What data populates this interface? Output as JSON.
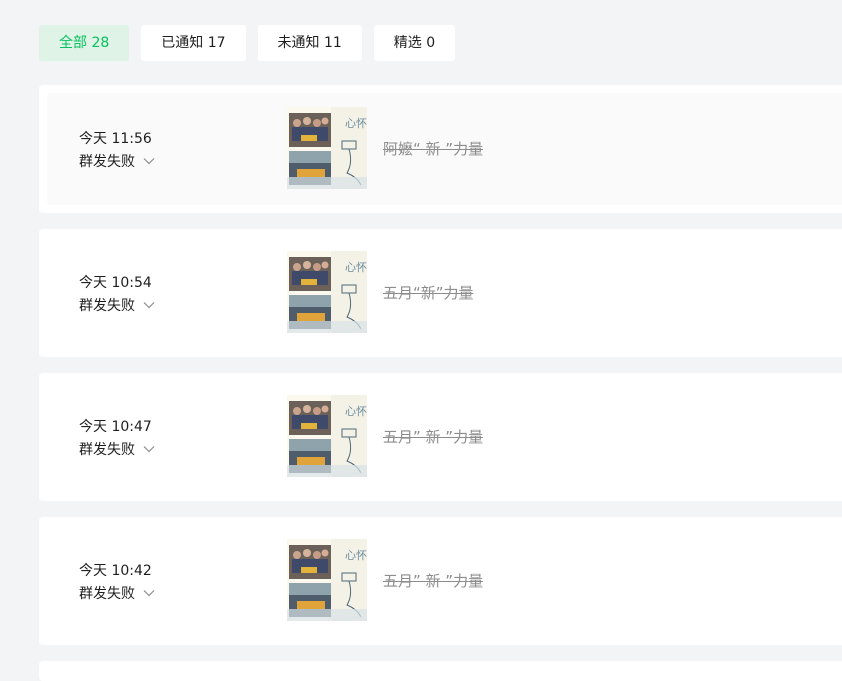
{
  "tabs": [
    {
      "label": "全部 28",
      "active": true
    },
    {
      "label": "已通知 17",
      "active": false
    },
    {
      "label": "未通知 11",
      "active": false
    },
    {
      "label": "精选 0",
      "active": false
    }
  ],
  "colors": {
    "accent": "#07c160",
    "accent_bg": "#dff3e6",
    "page_bg": "#f3f4f6",
    "muted_text": "#8c8c8c"
  },
  "messages": [
    {
      "time": "今天 11:56",
      "status": "群发失败",
      "title": "阿嬷“ 新 ”力量",
      "thumb_text": "心怀"
    },
    {
      "time": "今天 10:54",
      "status": "群发失败",
      "title": "五月“新”力量",
      "thumb_text": "心怀"
    },
    {
      "time": "今天 10:47",
      "status": "群发失败",
      "title": "五月” 新 ”力量",
      "thumb_text": "心怀"
    },
    {
      "time": "今天 10:42",
      "status": "群发失败",
      "title": "五月” 新 ”力量",
      "thumb_text": "心怀"
    }
  ],
  "icons": {
    "status_dropdown": "chevron-down-icon"
  }
}
